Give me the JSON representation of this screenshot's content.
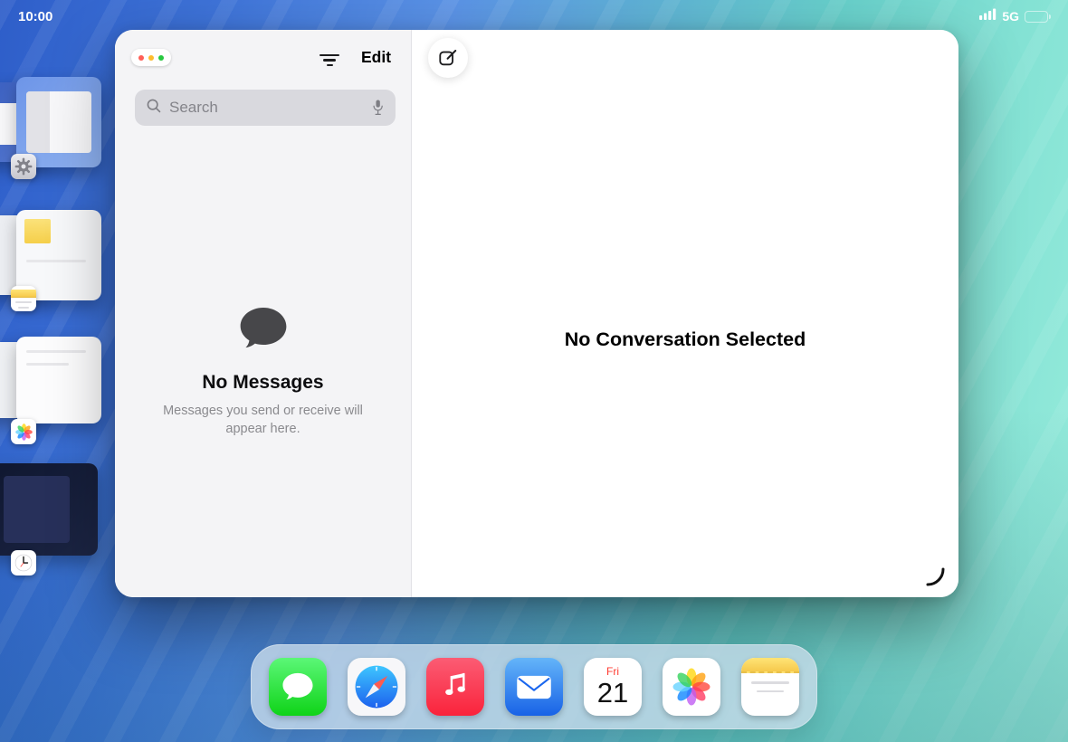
{
  "status_bar": {
    "time": "10:00",
    "network": "5G",
    "battery": "full"
  },
  "stage_manager": {
    "recent_apps": [
      {
        "app": "Settings",
        "icon": "settings-gear-icon"
      },
      {
        "app": "Notes",
        "icon": "notes-icon"
      },
      {
        "app": "Photos",
        "icon": "photos-icon"
      },
      {
        "app": "Clock",
        "icon": "clock-icon"
      }
    ]
  },
  "messages_window": {
    "window_controls_icon": "traffic-light-dots",
    "toolbar": {
      "filters_icon": "filter-lines-icon",
      "edit_label": "Edit",
      "compose_icon": "compose-square-pencil-icon"
    },
    "search": {
      "placeholder": "Search",
      "leading_icon": "search-magnifier-icon",
      "trailing_icon": "microphone-icon"
    },
    "list_empty": {
      "icon": "chat-bubble-icon",
      "title": "No Messages",
      "description": "Messages you send or receive will appear here."
    },
    "detail_empty": {
      "title": "No Conversation Selected"
    },
    "resize_indicator_icon": "corner-arc-icon"
  },
  "dock": {
    "apps": [
      {
        "name": "Messages",
        "icon": "messages-app-icon"
      },
      {
        "name": "Safari",
        "icon": "safari-app-icon"
      },
      {
        "name": "Music",
        "icon": "music-app-icon"
      },
      {
        "name": "Mail",
        "icon": "mail-app-icon"
      },
      {
        "name": "Calendar",
        "icon": "calendar-app-icon",
        "weekday": "Fri",
        "day": "21"
      },
      {
        "name": "Photos",
        "icon": "photos-app-icon"
      },
      {
        "name": "Notes",
        "icon": "notes-app-icon"
      }
    ]
  },
  "colors": {
    "messages_green_top": "#5BF777",
    "messages_green_bottom": "#0FD318",
    "safari_blue": "#1D62EE",
    "music_red": "#FA233B",
    "mail_blue": "#1A66EE",
    "calendar_red": "#FF3B30",
    "notes_yellow": "#F6C94C",
    "wallpaper_blue": "#3E73D8",
    "wallpaper_teal": "#84E2D4",
    "dock_background": "rgba(203,221,235,0.78)"
  }
}
